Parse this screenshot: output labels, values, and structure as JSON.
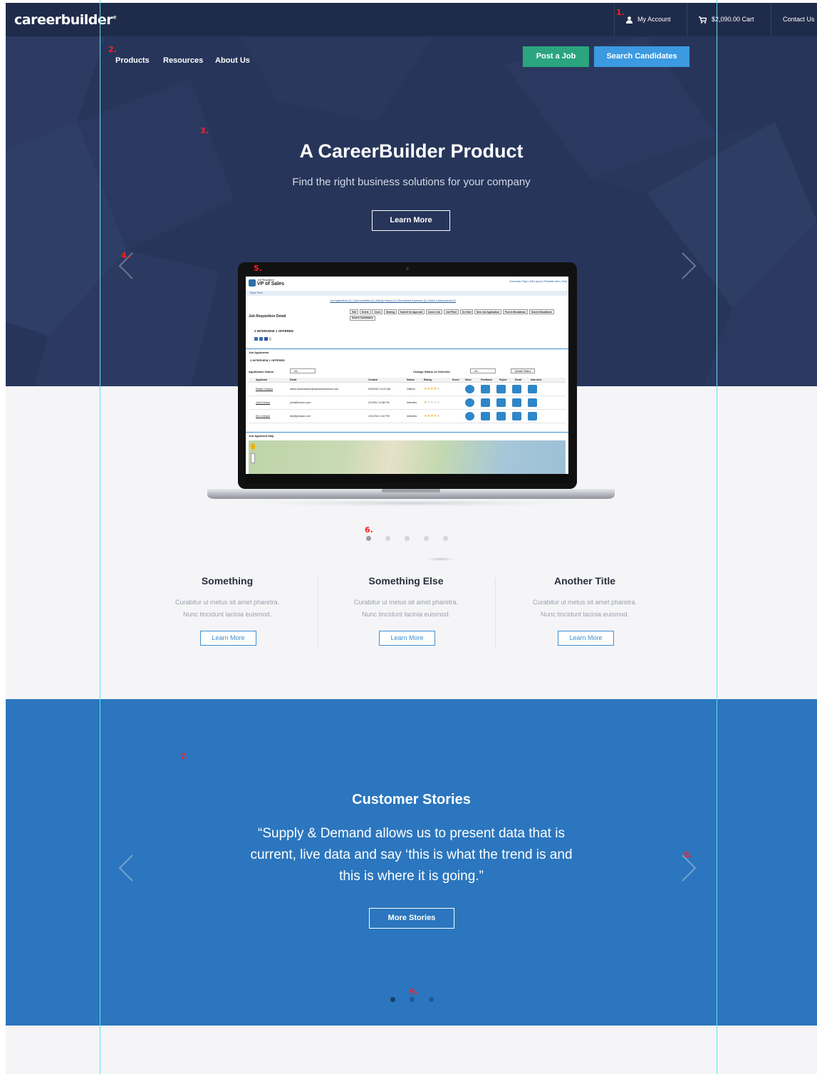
{
  "topbar": {
    "logo": "careerbuilder",
    "account_label": "My Account",
    "cart_label": "$2,090.00 Cart",
    "contact_label": "Contact Us"
  },
  "nav": {
    "items": [
      "Products",
      "Resources",
      "About Us"
    ],
    "post_job_label": "Post a Job",
    "search_candidates_label": "Search Candidates"
  },
  "hero": {
    "title": "A CareerBuilder Product",
    "subtitle": "Find the right business solutions for your company",
    "button_label": "Learn More"
  },
  "laptop_screen": {
    "page_label": "Job Requisition",
    "page_title": "VP of Sales",
    "header_links": "Customize Page | Edit Layout | Printable View | Help",
    "show_feed": "Show Feed",
    "tab_links": "Job Applications (3) | Open Activities (0) | Activity History (0) | Recruitment Expenses (0) | Notes & Attachments (0)",
    "detail_title": "Job Requisition Detail",
    "action_buttons": [
      "Edit",
      "Delete",
      "Clone",
      "Sharing",
      "Submit for Approval",
      "Cancel Job",
      "Job Filled",
      "On Hold",
      "New Job Application",
      "Post to Broadbean",
      "Search Broadbean",
      "Search Candidates"
    ],
    "summary_counts": "2 INTERVIEW  1 OFFERED",
    "applicants_section": "Job Applicants",
    "application_status_label": "Application Status",
    "change_status_label": "Change Status on Selected",
    "update_status_button": "Update Status",
    "filter_value": "--All--",
    "columns": [
      "Applicant",
      "Email",
      "Created",
      "Status",
      "Rating",
      "Score",
      "Move",
      "Feedback",
      "Reject",
      "Email",
      "Interview"
    ],
    "rows": [
      {
        "name": "Rafael Campos",
        "email": "david.vanheukelom@vanwexworkforce.com",
        "created": "5/30/2012 10:22 AM",
        "status": "Offered",
        "rating": 4
      },
      {
        "name": "John Ericson",
        "email": "john@ericson.com",
        "created": "2/1/2012 12:58 PM",
        "status": "Interview",
        "rating": 1
      },
      {
        "name": "Kim Johnson",
        "email": "kim@johnson.com",
        "created": "1/21/2012 1:42 PM",
        "status": "Interview",
        "rating": 4
      }
    ],
    "map_section": "Job Applicant Map"
  },
  "carousel": {
    "slides": 5,
    "active": 0
  },
  "features": [
    {
      "title": "Something",
      "line1": "Curabitur ul metus sit amet pharetra.",
      "line2": "Nunc tincidunt lacinia euismod.",
      "button": "Learn More"
    },
    {
      "title": "Something Else",
      "line1": "Curabitur ul metus sit amet pharetra.",
      "line2": "Nunc tincidunt lacinia euismod.",
      "button": "Learn More"
    },
    {
      "title": "Another Title",
      "line1": "Curabitur ul metus sit amet pharetra.",
      "line2": "Nunc tincidunt lacinia euismod.",
      "button": "Learn More"
    }
  ],
  "stories": {
    "title": "Customer Stories",
    "quote_line1": "“Supply & Demand allows us to present data that is",
    "quote_line2": "current, live data and say ‘this is what the trend is and",
    "quote_line3": "this is where it is going.”",
    "button_label": "More Stories",
    "slides": 3,
    "active": 0
  },
  "annotations": [
    "1.",
    "2.",
    "3.",
    "4.",
    "5.",
    "6.",
    "7.",
    "8.",
    "9."
  ],
  "colors": {
    "topbar": "#1f2b4a",
    "hero": "#27355a",
    "post_job": "#2aa57e",
    "search_candidates": "#3b9ae1",
    "stories": "#2b76be",
    "guide_lines": "#5fe0ef",
    "annotation": "#ff2020"
  }
}
